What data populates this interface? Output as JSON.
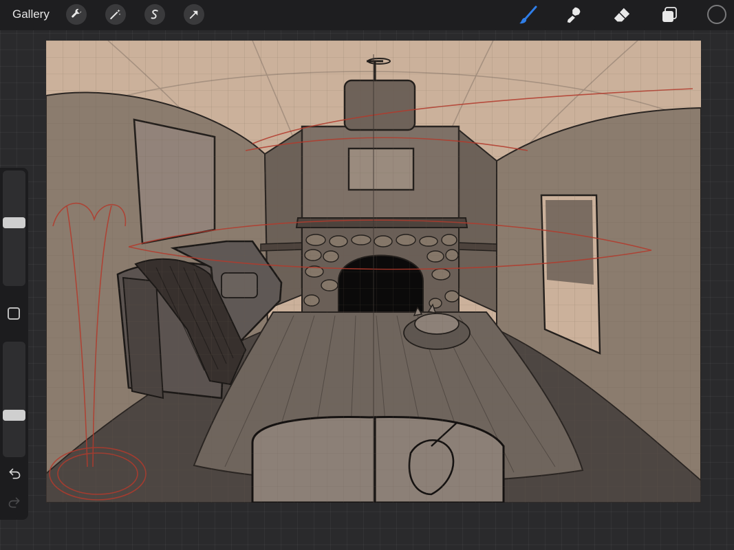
{
  "topbar": {
    "gallery_label": "Gallery",
    "left_tools": [
      "wrench-icon",
      "magic-wand-icon",
      "selection-s-icon",
      "transform-arrow-icon"
    ],
    "right_tools": [
      "brush-icon",
      "smudge-icon",
      "eraser-icon",
      "layers-icon",
      "color-swatch"
    ],
    "active_tool": "brush",
    "accent_color": "#2f7ee8",
    "current_color": "#1e1e20"
  },
  "sidebar": {
    "brush_size_level": 0.55,
    "opacity_level": 0.35,
    "controls": [
      "size-slider",
      "modifier-square",
      "opacity-slider",
      "undo-icon",
      "redo-icon"
    ]
  },
  "canvas": {
    "paper_color": "#cbb19b",
    "guide_color": "#b33a2c"
  }
}
